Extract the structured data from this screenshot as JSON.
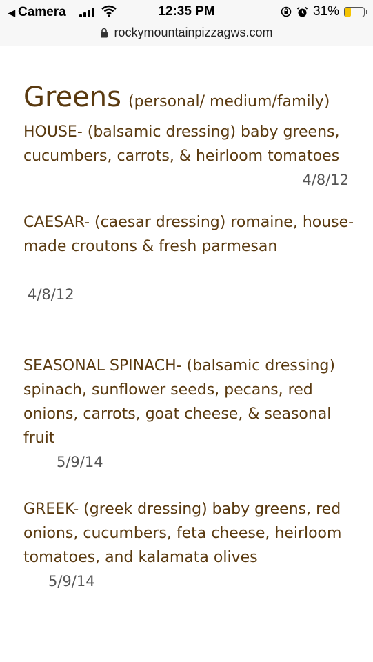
{
  "status_bar": {
    "back_app": "Camera",
    "time": "12:35 PM",
    "battery": "31%",
    "battery_level": 0.31
  },
  "url_bar": {
    "domain": "rockymountainpizzagws.com"
  },
  "page": {
    "heading": "Greens",
    "heading_sub": "(personal/ medium/family)",
    "items": [
      {
        "text": "HOUSE- (balsamic dressing) baby greens, cucumbers, carrots, & heirloom tomatoes",
        "date": "4/8/12"
      },
      {
        "text": "CAESAR- (caesar dressing) romaine, house-made croutons & fresh parmesan",
        "date": "4/8/12"
      },
      {
        "text": "SEASONAL SPINACH- (balsamic dressing) spinach, sunflower seeds, pecans, red onions, carrots, goat cheese, & seasonal fruit",
        "date": "5/9/14"
      },
      {
        "text": "GREEK- (greek dressing) baby greens, red onions, cucumbers, feta cheese, heirloom tomatoes, and kalamata olives",
        "date": "5/9/14"
      }
    ]
  }
}
